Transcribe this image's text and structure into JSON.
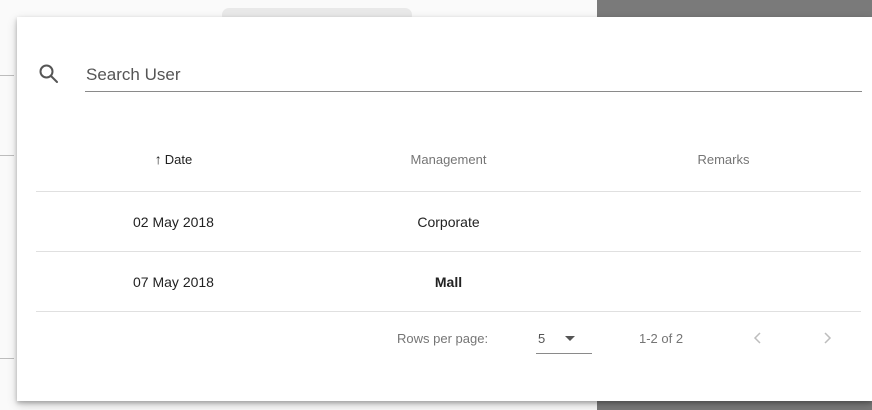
{
  "search": {
    "placeholder": "Search User",
    "value": ""
  },
  "table": {
    "sort_arrow": "↑",
    "columns": [
      "Date",
      "Management",
      "Remarks"
    ],
    "rows": [
      {
        "date": "02 May 2018",
        "management": "Corporate",
        "remarks": ""
      },
      {
        "date": "07 May 2018",
        "management": "Mall",
        "remarks": ""
      }
    ]
  },
  "pagination": {
    "rows_per_page_label": "Rows per page:",
    "rows_per_page_value": "5",
    "range_label": "1-2 of 2"
  },
  "icons": {
    "search": "search-icon",
    "dropdown": "arrow-drop-down-icon",
    "prev": "chevron-left-icon",
    "next": "chevron-right-icon"
  },
  "colors": {
    "backdrop": "#7a7a7a",
    "card": "#ffffff",
    "divider": "#e0e0e0"
  }
}
